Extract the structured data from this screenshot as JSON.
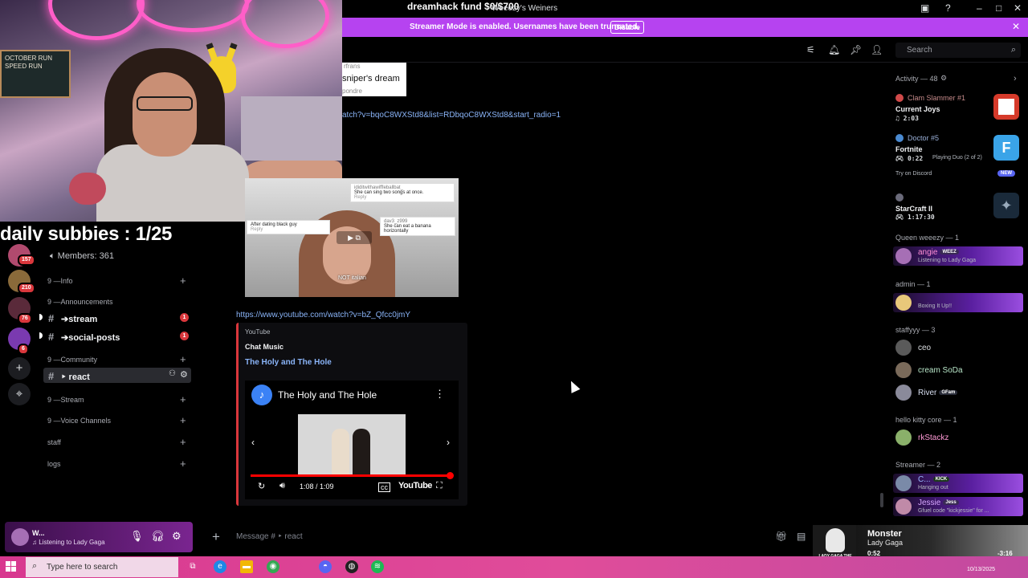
{
  "titlebar": {
    "fund_text": "dreamhack fund $0/$700",
    "server_title": "Weeezy's Weiners",
    "controls": [
      "inbox-icon",
      "help-icon",
      "minimize-icon",
      "maximize-icon",
      "close-icon"
    ]
  },
  "banner": {
    "text": "Streamer Mode is enabled. Usernames have been truncated.",
    "button": "Disable",
    "color": "#b643f0"
  },
  "toolbar": {
    "icons": [
      "threads-icon",
      "bell-icon",
      "pin-icon",
      "members-icon"
    ],
    "search_placeholder": "Search"
  },
  "overlay": {
    "subbies": "daily subbies : 1/25",
    "chalkboard": "OCTOBER RUN SPEED RUN"
  },
  "rail": {
    "badges": [
      "157",
      "210",
      "76",
      "6"
    ],
    "add_server": "+",
    "discover": "⌖"
  },
  "channels": {
    "members": "Members: 361",
    "categories": {
      "info": "9 —Info",
      "announcements": "9 —Announcements",
      "community": "9 —Community",
      "stream": "9 —Stream",
      "voice": "9 —Voice Channels",
      "staff": "staff",
      "logs": "logs"
    },
    "stream": {
      "name": "➔stream",
      "unread": "1"
    },
    "social": {
      "name": "➔social-posts",
      "unread": "1"
    },
    "react": {
      "name": "‣ react"
    }
  },
  "chat": {
    "fragment_top": "rfrans",
    "fragment_main": "sniper's dream",
    "fragment_bottom": "pondre",
    "link1": "atch?v=bqoC8WXStd8&list=RDbqoC8WXStd8&start_radio=1",
    "tiktok": {
      "bubble1_user": "ididitwithawiffleballbat_",
      "bubble1": "She can sing two songs at once.",
      "bubble2": "After dating black guy",
      "bubble3_user": "dav3_z999",
      "bubble3": "She can eat a banana horizontally",
      "caption": "NOT italian",
      "reply": "Reply"
    },
    "link2": "https://www.youtube.com/watch?v=bZ_Qfcc0jmY",
    "youtube": {
      "provider": "YouTube",
      "author": "Chat Music",
      "title": "The Holy and The Hole",
      "player_title": "The Holy and The Hole",
      "time": "1:08 / 1:09",
      "wordmark": "YouTube",
      "progress_fraction": 0.985
    }
  },
  "members": {
    "activity_header": "Activity — 48",
    "activities": {
      "a1_user": "Clam Slammer #1",
      "a1_title": "Current Joys",
      "a1_time": "2:03",
      "a2_user": "Doctor #5",
      "a2_title": "Fortnite",
      "a2_time": "0:22",
      "a2_detail": "Playing Duo (2 of 2)",
      "try_discord": "Try on Discord",
      "new_badge": "NEW",
      "a3_title": "StarCraft II",
      "a3_time": "1:17:30"
    },
    "queen_header": "Queen weeezy — 1",
    "angie": {
      "name": "angie",
      "tag": "WEEZ",
      "status": "Listening to Lady Gaga"
    },
    "admin_header": "admin — 1",
    "admin": {
      "status": "Boxing It Up!!"
    },
    "staff_header": "staffyyy — 3",
    "staff": [
      "ceo",
      "cream SoDa",
      "River"
    ],
    "river_tag": "GFam",
    "kitty_header": "hello kitty core — 1",
    "kitty": "rkStackz",
    "streamer_header": "Streamer — 2",
    "s1": {
      "name": "C...",
      "tag": "KICK",
      "status": "Hanging out"
    },
    "s2": {
      "name": "Jessie",
      "tag": "Jess",
      "status": "Gfuel code \"kickjessie\" for ..."
    }
  },
  "userpanel": {
    "name": "W...",
    "status": "Listening to Lady Gaga"
  },
  "composer": {
    "placeholder": "Message # ‣ react"
  },
  "music": {
    "title": "Monster",
    "artist": "Lady Gaga",
    "elapsed": "0:52",
    "remaining": "-3:16",
    "album_text": "LADY GAGA THE FAME MONSTER",
    "progress_fraction": 0.21
  },
  "taskbar": {
    "search_placeholder": "Type here to search",
    "date": "10/13/2025"
  }
}
